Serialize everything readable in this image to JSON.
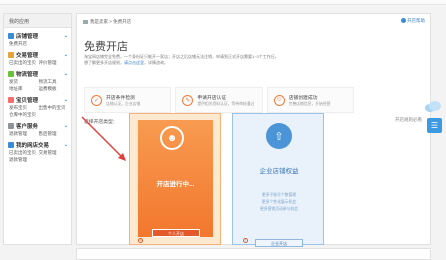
{
  "sidebar": {
    "header": "我的应用",
    "groups": [
      {
        "title": "店铺管理",
        "color": "#3a8bd8",
        "links": [
          "免费开店",
          ""
        ]
      },
      {
        "title": "交易管理",
        "color": "#e6a23c",
        "links": [
          "已卖出的宝贝",
          "评价管理"
        ]
      },
      {
        "title": "物流管理",
        "color": "#67c23a",
        "links": [
          "发货",
          "物流工具",
          "地址库",
          "运费模板"
        ]
      },
      {
        "title": "宝贝管理",
        "color": "#f56c6c",
        "links": [
          "发布宝贝",
          "出售中的宝贝",
          "仓库中的宝贝",
          ""
        ]
      },
      {
        "title": "客户服务",
        "color": "#909399",
        "links": [
          "退款管理",
          "售后管理"
        ]
      },
      {
        "title": "我的网店交易",
        "color": "#3a8bd8",
        "links": [
          "已卖出的宝贝",
          "交易管理",
          "退款管理",
          ""
        ]
      }
    ]
  },
  "main": {
    "breadcrumb_home": "我是卖家",
    "breadcrumb_sep": ">",
    "breadcrumb_current": "免费开店",
    "help_label": "开店帮助",
    "title": "免费开店",
    "desc_line1": "淘宝网店铺完全免费，一个身份证只能开一家店；开店之后店铺无法注销，申请到正式开店需要1~3个工作日。",
    "desc_line2_prefix": "想了解更多开店规则，",
    "desc_line2_link": "请点击这里",
    "desc_line2_suffix": "，详情咨询。",
    "steps": [
      {
        "icon": "✓",
        "t1": "开店条件检测",
        "t2": "店铺认证，企业店铺"
      },
      {
        "icon": "✎",
        "t1": "申请开店认证",
        "t2": "提供相关资料认证，等待审核通过"
      },
      {
        "icon": "☺",
        "t1": "店铺创建成功",
        "t2": "完善店铺信息，开始经营"
      }
    ],
    "choose_label": "选择开店类型：",
    "more_label": "开店规则必看",
    "open_card": {
      "icon": "person-icon",
      "status": "开店进行中...",
      "button": "个人开店"
    },
    "rights_card": {
      "title": "企业店铺权益",
      "items": [
        "更多子账号个数管理",
        "更多个性化展示机会",
        "更多营销活动参与机会"
      ],
      "button": "企业开店"
    }
  },
  "colors": {
    "accent": "#3a8bd8",
    "orange": "#f2772e",
    "blue_card": "#e9f2fb",
    "arrow": "#e0403a"
  }
}
